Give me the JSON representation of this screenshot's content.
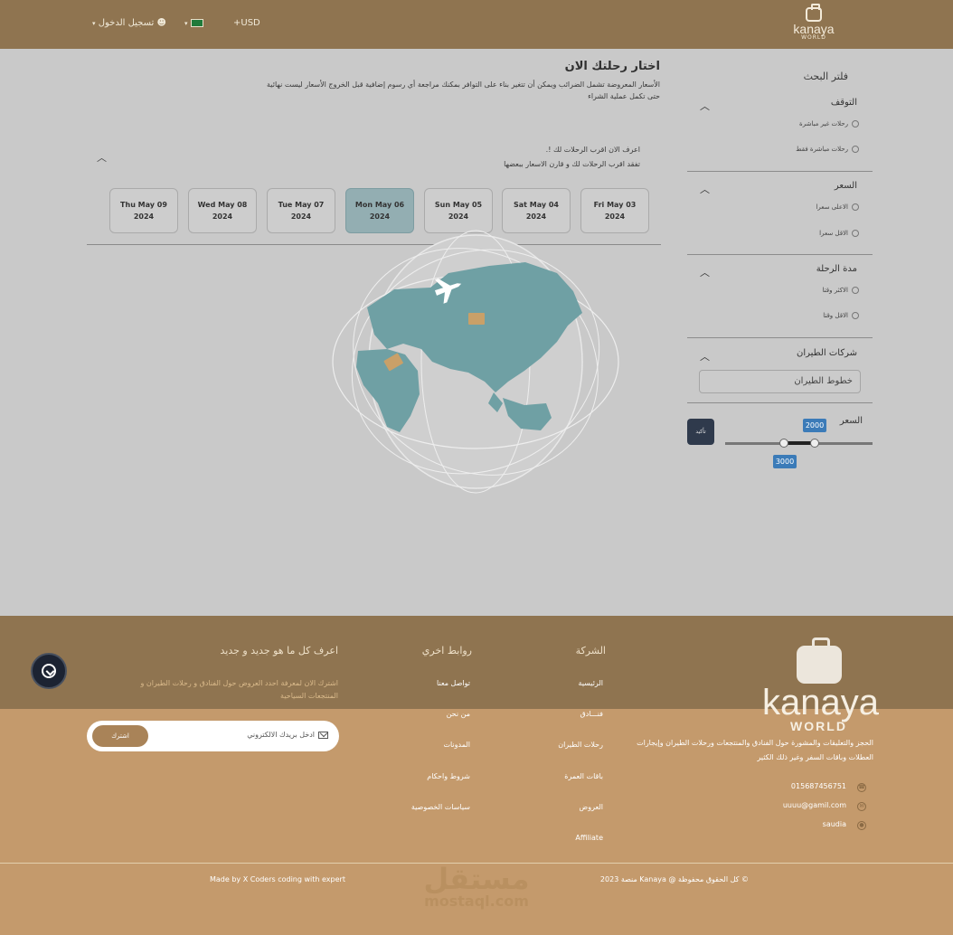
{
  "header": {
    "logo_name": "kanaya",
    "logo_sub": "WORLD",
    "login": "تسجيل الدخول",
    "currency": "+USD"
  },
  "main": {
    "title": "اختار رحلتك الان",
    "subtitle": "الأسعار المعروضة تشمل الضرائب ويمكن أن تتغير بناء على التوافر بمكنك مراجعة أي رسوم إضافية قبل الخروج الأسعار ليست نهائية حتى تكمل عملية الشراء",
    "hint_line1": "اعرف الان اقرب الرحلات لك !.",
    "hint_line2": "تفقد اقرب الرحلات لك و قارن الاسعار ببعضها",
    "dates": [
      {
        "day": "Fri May 03",
        "year": "2024",
        "active": false
      },
      {
        "day": "Sat May 04",
        "year": "2024",
        "active": false
      },
      {
        "day": "Sun May 05",
        "year": "2024",
        "active": false
      },
      {
        "day": "Mon May 06",
        "year": "2024",
        "active": true
      },
      {
        "day": "Tue May 07",
        "year": "2024",
        "active": false
      },
      {
        "day": "Wed May 08",
        "year": "2024",
        "active": false
      },
      {
        "day": "Thu May 09",
        "year": "2024",
        "active": false
      }
    ]
  },
  "sidebar": {
    "title": "فلتر البحث",
    "sections": {
      "stops": {
        "title": "التوقف",
        "options": [
          "رحلات غير مباشرة",
          "رحلات مباشرة فقط"
        ]
      },
      "price": {
        "title": "السعر",
        "options": [
          "الاعلى سعرا",
          "الاقل سعرا"
        ]
      },
      "duration": {
        "title": "مدة الرحلة",
        "options": [
          "الاكثر وقتا",
          "الاقل وقتا"
        ]
      },
      "airlines": {
        "title": "شركات الطيران",
        "input_value": "خطوط الطيران"
      }
    },
    "price_range": {
      "label": "السعر",
      "min": 2000,
      "max": 3000,
      "confirm": "تأكيد"
    }
  },
  "footer": {
    "company": {
      "title": "الشركة",
      "links": [
        "الرئيسية",
        "فنـــادق",
        "رحلات الطيران",
        "باقات العمرة",
        "العروض",
        "Affiliate"
      ]
    },
    "other_links": {
      "title": "روابط اخري",
      "links": [
        "تواصل معنا",
        "من نحن",
        "المدونات",
        "شروط واحكام",
        "سياسات الخصوصية"
      ]
    },
    "newsletter": {
      "title": "اعرف كل ما هو جديد و جديد",
      "desc": "اشترك الان لمعرفة احدد العروض حول الفنادق و رحلات الطيران و المنتجعات السياحية",
      "placeholder": "ادخل بريدك الالكتروني",
      "button": "اشترك"
    },
    "brand": {
      "name": "kanaya",
      "sub": "WORLD",
      "about": "الحجز والتعليقات والمشورة حول الفنادق والمنتجعات ورحلات الطيران وإيجارات العطلات وباقات السفر وغير ذلك الكثير"
    },
    "contact": {
      "phone": "015687456751",
      "email": "uuuu@gamil.com",
      "location": "saudia"
    },
    "copyright_right": "© كل الحقوق محفوظة @ Kanaya منصة 2023",
    "copyright_left": "Made by X Coders coding with expert",
    "watermark_1": "مستقل",
    "watermark_2": "mostaql.com"
  },
  "colors": {
    "header": "#8f7450",
    "footer": "#c49a6c",
    "active_date": "#93aeb2",
    "tooltip": "#3b7bb8"
  }
}
